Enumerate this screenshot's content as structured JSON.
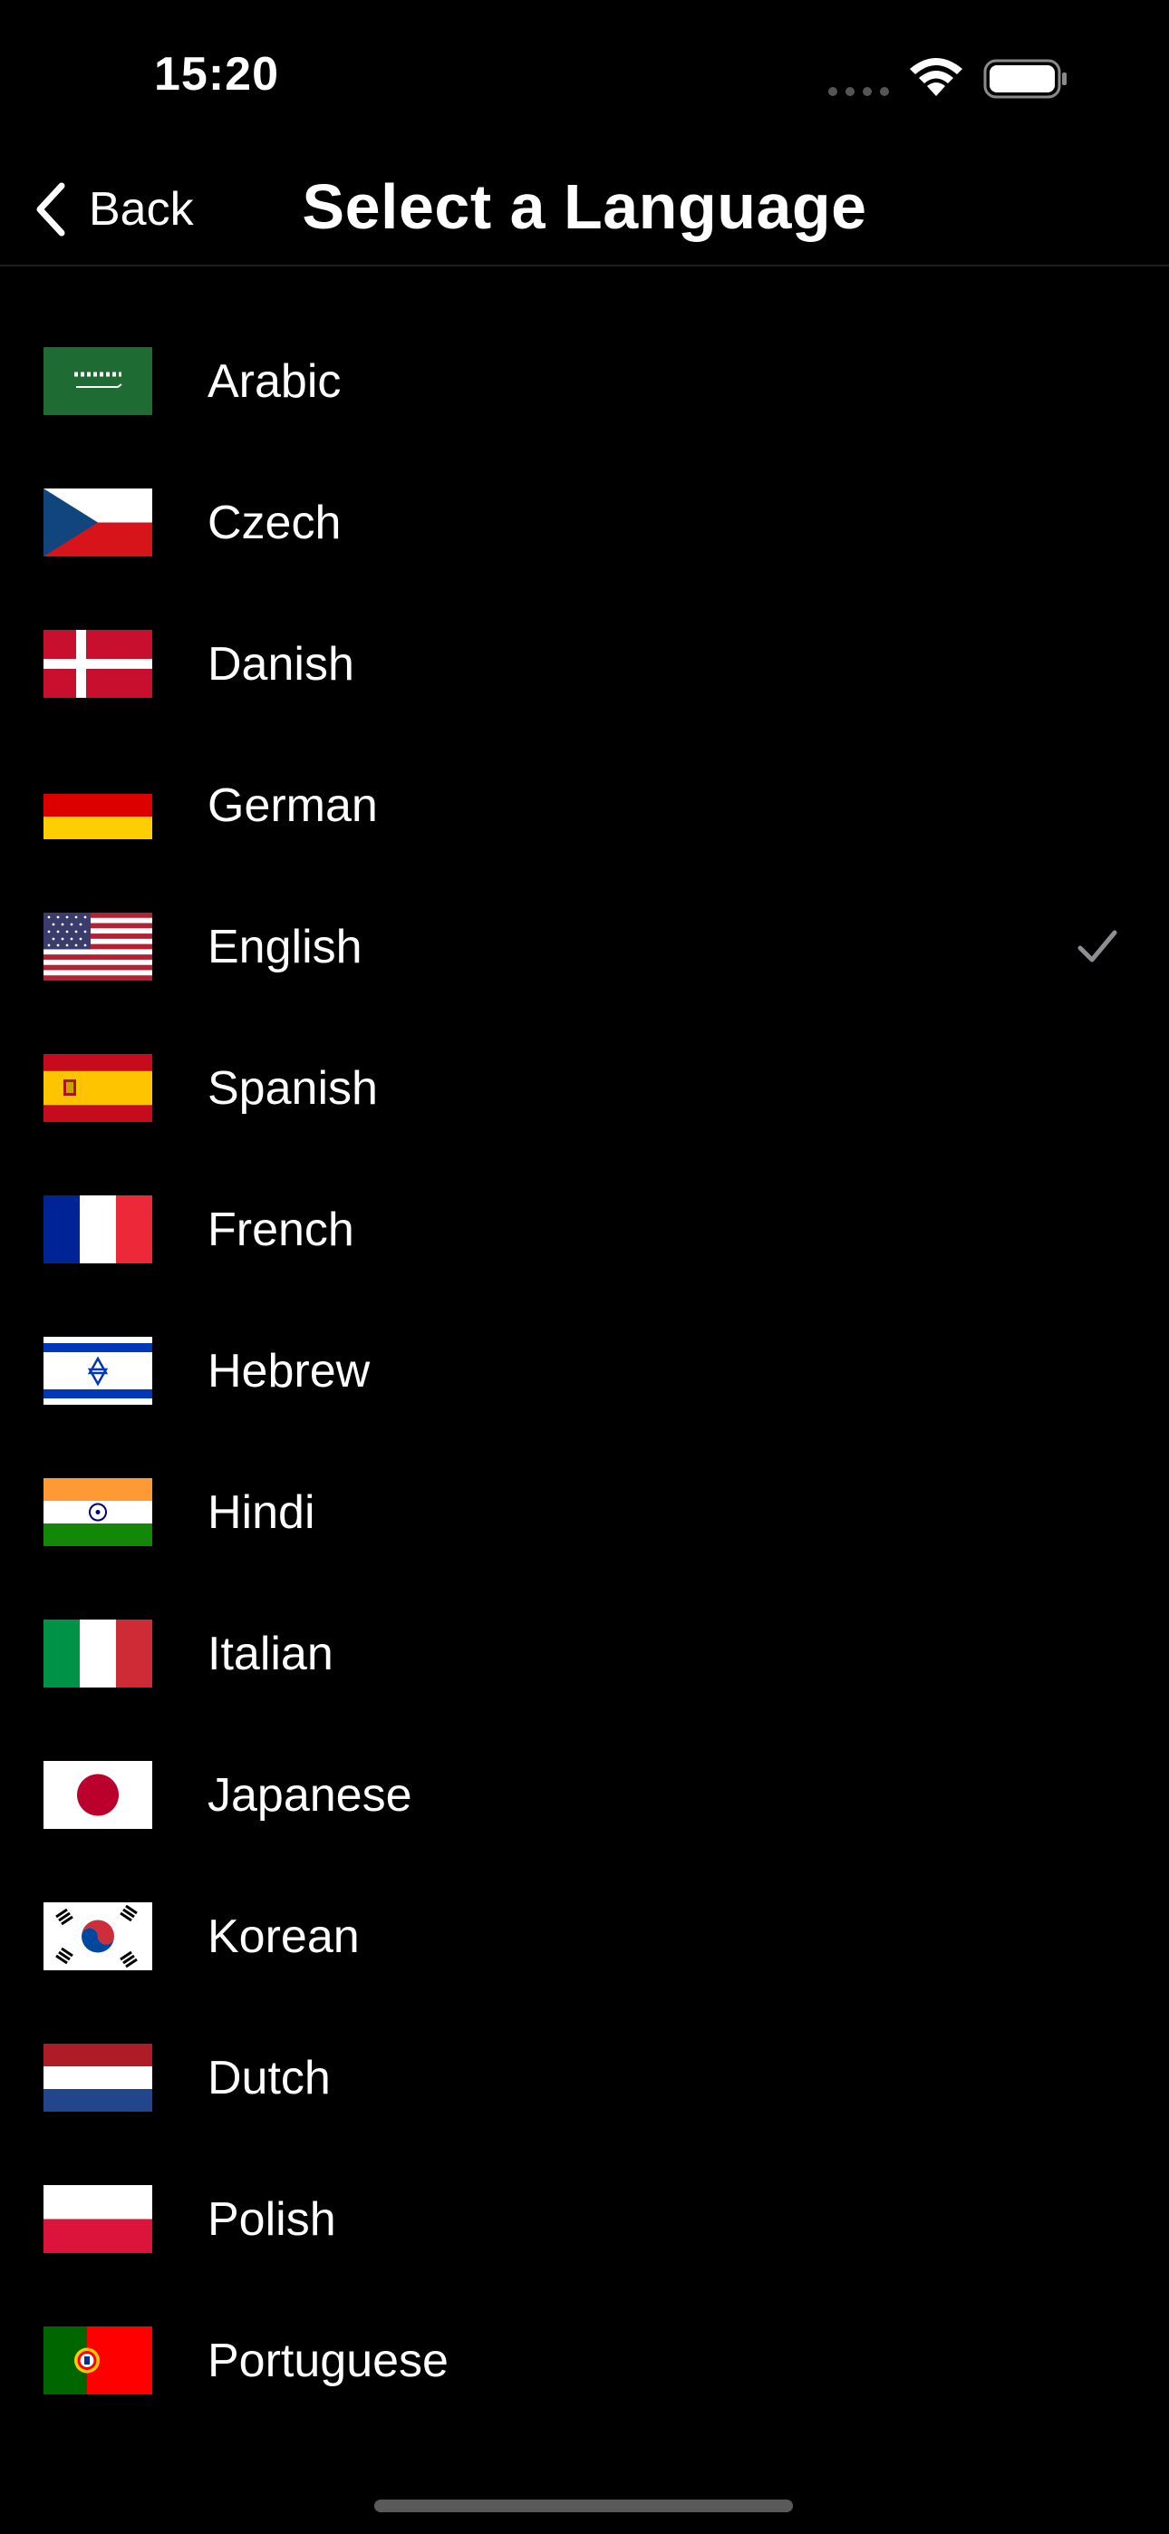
{
  "status_bar": {
    "time": "15:20"
  },
  "nav": {
    "back_label": "Back",
    "title": "Select a Language"
  },
  "languages": [
    {
      "label": "Arabic",
      "flag": "saudi-arabia-flag-icon",
      "selected": false
    },
    {
      "label": "Czech",
      "flag": "czech-flag-icon",
      "selected": false
    },
    {
      "label": "Danish",
      "flag": "danish-flag-icon",
      "selected": false
    },
    {
      "label": "German",
      "flag": "german-flag-icon",
      "selected": false
    },
    {
      "label": "English",
      "flag": "us-flag-icon",
      "selected": true
    },
    {
      "label": "Spanish",
      "flag": "spanish-flag-icon",
      "selected": false
    },
    {
      "label": "French",
      "flag": "french-flag-icon",
      "selected": false
    },
    {
      "label": "Hebrew",
      "flag": "israeli-flag-icon",
      "selected": false
    },
    {
      "label": "Hindi",
      "flag": "indian-flag-icon",
      "selected": false
    },
    {
      "label": "Italian",
      "flag": "italian-flag-icon",
      "selected": false
    },
    {
      "label": "Japanese",
      "flag": "japanese-flag-icon",
      "selected": false
    },
    {
      "label": "Korean",
      "flag": "korean-flag-icon",
      "selected": false
    },
    {
      "label": "Dutch",
      "flag": "dutch-flag-icon",
      "selected": false
    },
    {
      "label": "Polish",
      "flag": "polish-flag-icon",
      "selected": false
    },
    {
      "label": "Portuguese",
      "flag": "portuguese-flag-icon",
      "selected": false
    }
  ],
  "colors": {
    "background": "#000000",
    "text": "#ffffff",
    "checkmark": "#8e8e93"
  }
}
